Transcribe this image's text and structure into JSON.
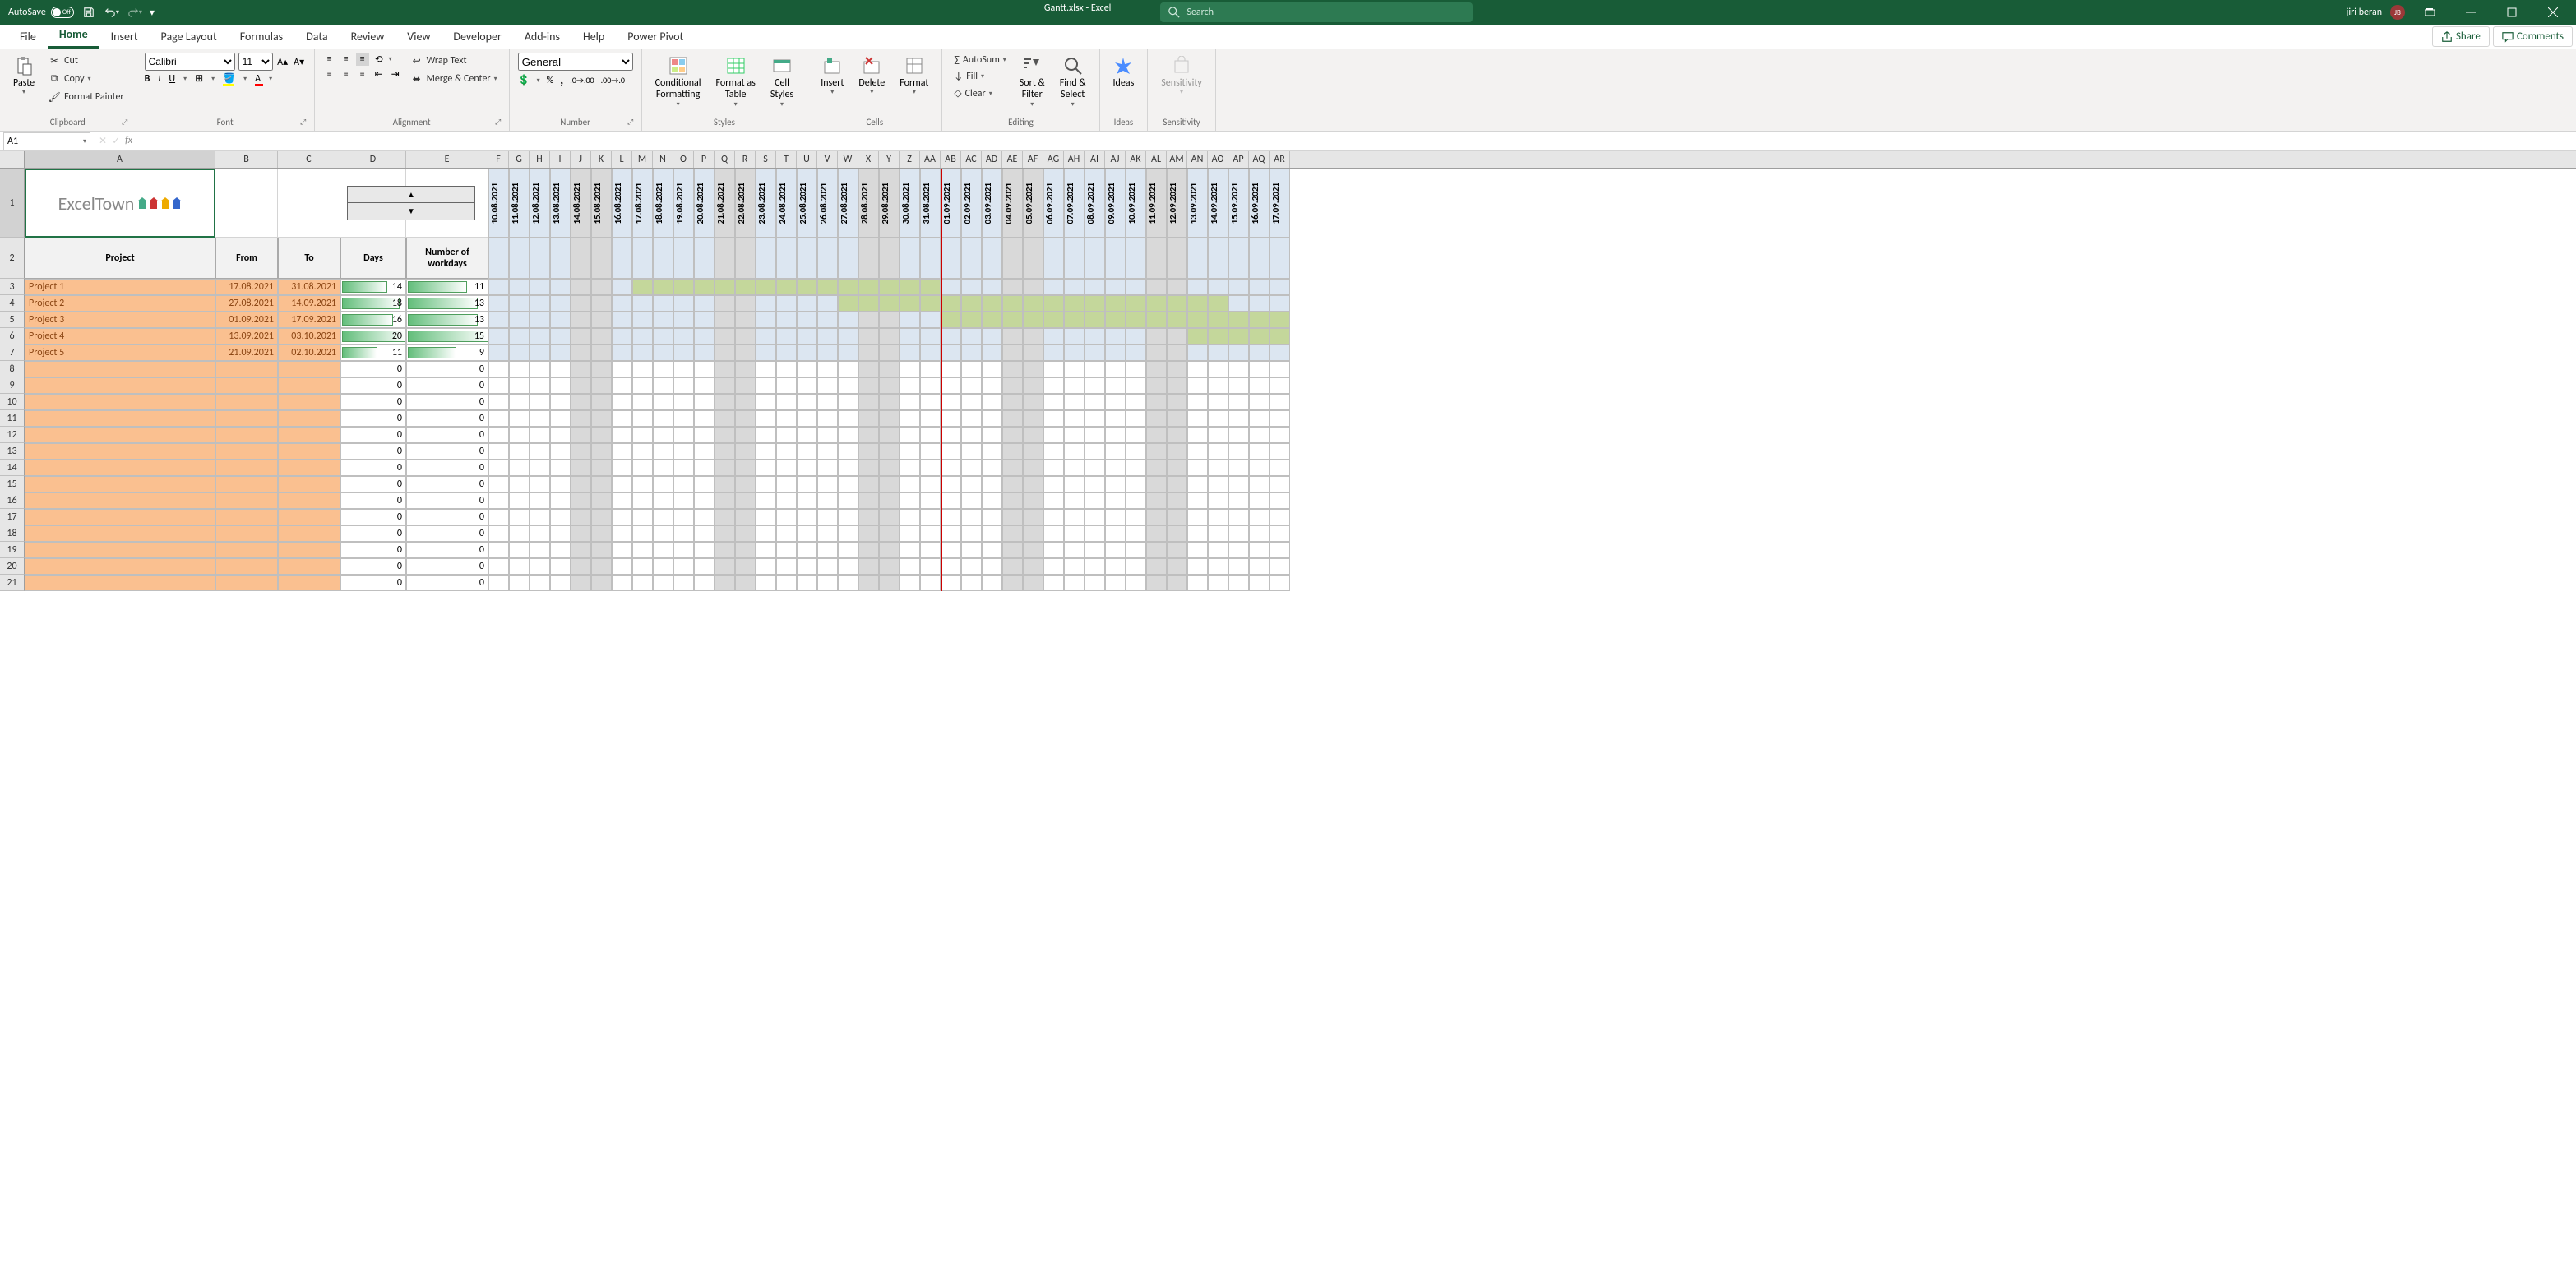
{
  "titlebar": {
    "autosave_label": "AutoSave",
    "autosave_state": "Off",
    "doc_title": "Gantt.xlsx - Excel",
    "search_placeholder": "Search",
    "user_name": "jiri beran",
    "user_initials": "JB"
  },
  "tabs": {
    "file": "File",
    "home": "Home",
    "insert": "Insert",
    "page_layout": "Page Layout",
    "formulas": "Formulas",
    "data": "Data",
    "review": "Review",
    "view": "View",
    "developer": "Developer",
    "addins": "Add-ins",
    "help": "Help",
    "power_pivot": "Power Pivot",
    "share": "Share",
    "comments": "Comments"
  },
  "ribbon": {
    "clipboard": {
      "paste": "Paste",
      "cut": "Cut",
      "copy": "Copy",
      "format_painter": "Format Painter",
      "label": "Clipboard"
    },
    "font": {
      "name": "Calibri",
      "size": "11",
      "label": "Font"
    },
    "alignment": {
      "wrap_text": "Wrap Text",
      "merge_center": "Merge & Center",
      "label": "Alignment"
    },
    "number": {
      "format": "General",
      "label": "Number"
    },
    "styles": {
      "conditional": "Conditional\nFormatting",
      "format_as_table": "Format as\nTable",
      "cell_styles": "Cell\nStyles",
      "label": "Styles"
    },
    "cells": {
      "insert": "Insert",
      "delete": "Delete",
      "format": "Format",
      "label": "Cells"
    },
    "editing": {
      "autosum": "AutoSum",
      "fill": "Fill",
      "clear": "Clear",
      "sort_filter": "Sort &\nFilter",
      "find_select": "Find &\nSelect",
      "label": "Editing"
    },
    "ideas": {
      "ideas": "Ideas",
      "label": "Ideas"
    },
    "sensitivity": {
      "sensitivity": "Sensitivity",
      "label": "Sensitivity"
    }
  },
  "namebox": "A1",
  "logo_text": "ExcelTown",
  "headers": {
    "project": "Project",
    "from": "From",
    "to": "To",
    "days": "Days",
    "workdays": "Number of\nworkdays"
  },
  "col_letters": [
    "A",
    "B",
    "C",
    "D",
    "E",
    "F",
    "G",
    "H",
    "I",
    "J",
    "K",
    "L",
    "M",
    "N",
    "O",
    "P",
    "Q",
    "R",
    "S",
    "T",
    "U",
    "V",
    "W",
    "X",
    "Y",
    "Z",
    "AA",
    "AB",
    "AC",
    "AD",
    "AE",
    "AF",
    "AG",
    "AH",
    "AI",
    "AJ",
    "AK",
    "AL",
    "AM",
    "AN",
    "AO",
    "AP",
    "AQ",
    "AR"
  ],
  "date_headers": [
    "10.08.2021",
    "11.08.2021",
    "12.08.2021",
    "13.08.2021",
    "14.08.2021",
    "15.08.2021",
    "16.08.2021",
    "17.08.2021",
    "18.08.2021",
    "19.08.2021",
    "20.08.2021",
    "21.08.2021",
    "22.08.2021",
    "23.08.2021",
    "24.08.2021",
    "25.08.2021",
    "26.08.2021",
    "27.08.2021",
    "28.08.2021",
    "29.08.2021",
    "30.08.2021",
    "31.08.2021",
    "01.09.2021",
    "02.09.2021",
    "03.09.2021",
    "04.09.2021",
    "05.09.2021",
    "06.09.2021",
    "07.09.2021",
    "08.09.2021",
    "09.09.2021",
    "10.09.2021",
    "11.09.2021",
    "12.09.2021",
    "13.09.2021",
    "14.09.2021",
    "15.09.2021",
    "16.09.2021",
    "17.09.2021"
  ],
  "weekend_idx": [
    4,
    5,
    11,
    12,
    18,
    19,
    25,
    26,
    32,
    33
  ],
  "today_idx": 22,
  "projects": [
    {
      "name": "Project 1",
      "from": "17.08.2021",
      "to": "31.08.2021",
      "days": 14,
      "workdays": 11,
      "start": 7,
      "end": 21
    },
    {
      "name": "Project 2",
      "from": "27.08.2021",
      "to": "14.09.2021",
      "days": 18,
      "workdays": 13,
      "start": 17,
      "end": 35
    },
    {
      "name": "Project 3",
      "from": "01.09.2021",
      "to": "17.09.2021",
      "days": 16,
      "workdays": 13,
      "start": 22,
      "end": 38
    },
    {
      "name": "Project 4",
      "from": "13.09.2021",
      "to": "03.10.2021",
      "days": 20,
      "workdays": 15,
      "start": 34,
      "end": 39
    },
    {
      "name": "Project 5",
      "from": "21.09.2021",
      "to": "02.10.2021",
      "days": 11,
      "workdays": 9,
      "start": 40,
      "end": 40
    }
  ],
  "max_days": 20,
  "max_workdays": 15,
  "empty_row_count": 14,
  "chart_data": {
    "type": "gantt",
    "title": "ExcelTown Gantt",
    "date_axis_start": "10.08.2021",
    "date_axis_end": "17.09.2021",
    "today_marker": "01.09.2021",
    "series": [
      {
        "name": "Project 1",
        "from": "17.08.2021",
        "to": "31.08.2021",
        "days": 14,
        "workdays": 11
      },
      {
        "name": "Project 2",
        "from": "27.08.2021",
        "to": "14.09.2021",
        "days": 18,
        "workdays": 13
      },
      {
        "name": "Project 3",
        "from": "01.09.2021",
        "to": "17.09.2021",
        "days": 16,
        "workdays": 13
      },
      {
        "name": "Project 4",
        "from": "13.09.2021",
        "to": "03.10.2021",
        "days": 20,
        "workdays": 15
      },
      {
        "name": "Project 5",
        "from": "21.09.2021",
        "to": "02.10.2021",
        "days": 11,
        "workdays": 9
      }
    ]
  }
}
